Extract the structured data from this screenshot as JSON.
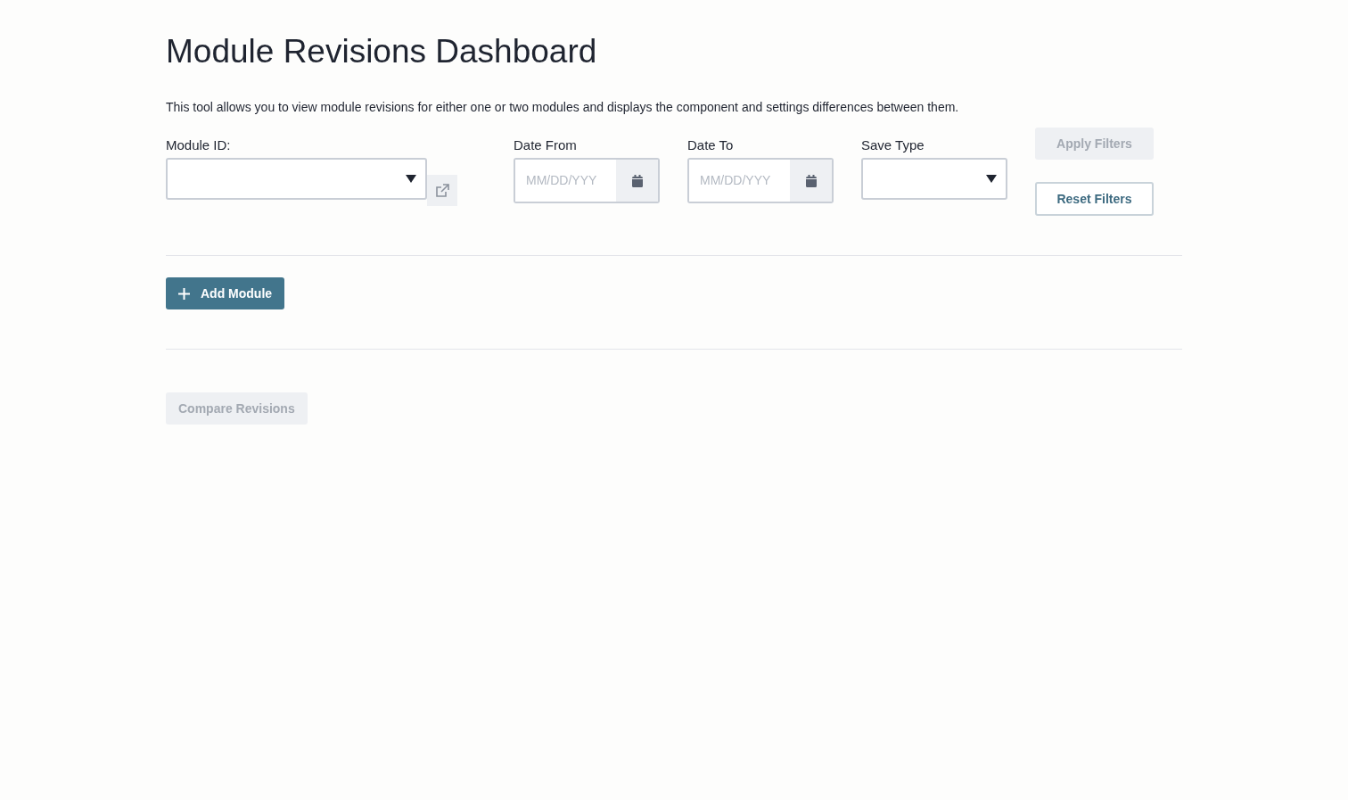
{
  "title": "Module Revisions Dashboard",
  "description": "This tool allows you to view module revisions for either one or two modules and displays the component and settings differences between them.",
  "filters": [
    {
      "kind": "select",
      "label": "Module ID:",
      "link_button": true
    },
    {
      "kind": "date",
      "label": "Date From",
      "placeholder": "MM/DD/YYY"
    },
    {
      "kind": "date",
      "label": "Date To",
      "placeholder": "MM/DD/YYY"
    },
    {
      "kind": "select",
      "label": "Save Type",
      "link_button": false
    }
  ],
  "filter_buttons": [
    {
      "label": "Apply Filters",
      "disabled": true
    },
    {
      "label": "Reset Filters",
      "disabled": false
    }
  ],
  "add_button": {
    "label": "Add Module",
    "disabled": false
  },
  "compare_button": {
    "label": "Compare Revisions",
    "disabled": true
  }
}
